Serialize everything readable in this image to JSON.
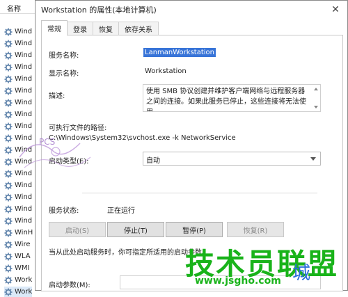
{
  "services_list": {
    "header": "名称",
    "items": [
      "Wind",
      "Wind",
      "Wind",
      "Wind",
      "Wind",
      "Wind",
      "Wind",
      "Wind",
      "Wind",
      "Wind",
      "Wind",
      "Wind",
      "Wind",
      "Wind",
      "Wind",
      "Wind",
      "Wind",
      "WinH",
      "Wire",
      "WLA",
      "WMI",
      "Work",
      "Work"
    ]
  },
  "dialog": {
    "title": "Workstation 的属性(本地计算机)",
    "close_glyph": "✕",
    "tabs": [
      "常规",
      "登录",
      "恢复",
      "依存关系"
    ],
    "active_tab": 0,
    "service_name_label": "服务名称:",
    "service_name_value": "LanmanWorkstation",
    "display_name_label": "显示名称:",
    "display_name_value": "Workstation",
    "description_label": "描述:",
    "description_value": "使用 SMB 协议创建并维护客户端网络与远程服务器之间的连接。如果此服务已停止，这些连接将无法使用。",
    "exe_path_label": "可执行文件的路径:",
    "exe_path_value": "C:\\Windows\\System32\\svchost.exe -k NetworkService",
    "startup_type_label": "启动类型(E):",
    "startup_type_value": "自动",
    "status_label": "服务状态:",
    "status_value": "正在运行",
    "buttons": {
      "start": "启动(S)",
      "stop": "停止(T)",
      "pause": "暂停(P)",
      "resume": "恢复(R)"
    },
    "hint": "当从此处启动服务时，你可指定所适用的启动参数。",
    "start_params_label": "启动参数(M):"
  },
  "watermark": {
    "brand": "技术员联盟",
    "url": "www.jsgho.com",
    "logo_text": "PCS",
    "side_char": "城"
  },
  "colors": {
    "selection": "#3874d8",
    "brand_green": "#19b31a",
    "brand_blue": "#2a6dd9"
  }
}
